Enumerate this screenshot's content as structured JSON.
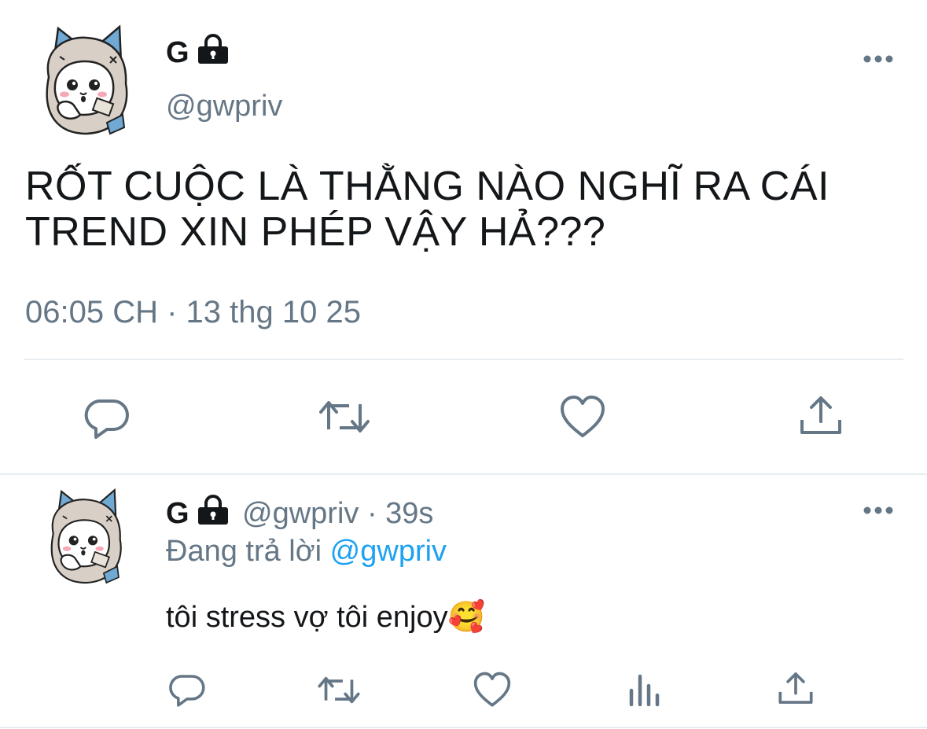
{
  "colors": {
    "secondary": "#657786",
    "accent": "#1da1f2",
    "text": "#14171a",
    "divider": "#e6ecf0"
  },
  "main_tweet": {
    "display_name": "G",
    "handle": "@gwpriv",
    "text_line1": "RỐT CUỘC LÀ THẰNG NÀO NGHĨ RA CÁI",
    "text_line2": "TREND XIN PHÉP VẬY HẢ???",
    "timestamp": "06:05 CH · 13 thg 10 25",
    "icons": [
      "lock-icon",
      "more-icon",
      "reply-icon",
      "retweet-icon",
      "like-icon",
      "share-icon"
    ]
  },
  "reply_tweet": {
    "display_name": "G",
    "handle": "@gwpriv",
    "time": "· 39s",
    "replying_prefix": "Đang trả lời",
    "replying_to": "@gwpriv",
    "text": "tôi stress vợ tôi enjoy",
    "emoji": "🥰",
    "icons": [
      "lock-icon",
      "more-icon",
      "reply-icon",
      "retweet-icon",
      "like-icon",
      "analytics-icon",
      "share-icon"
    ]
  }
}
